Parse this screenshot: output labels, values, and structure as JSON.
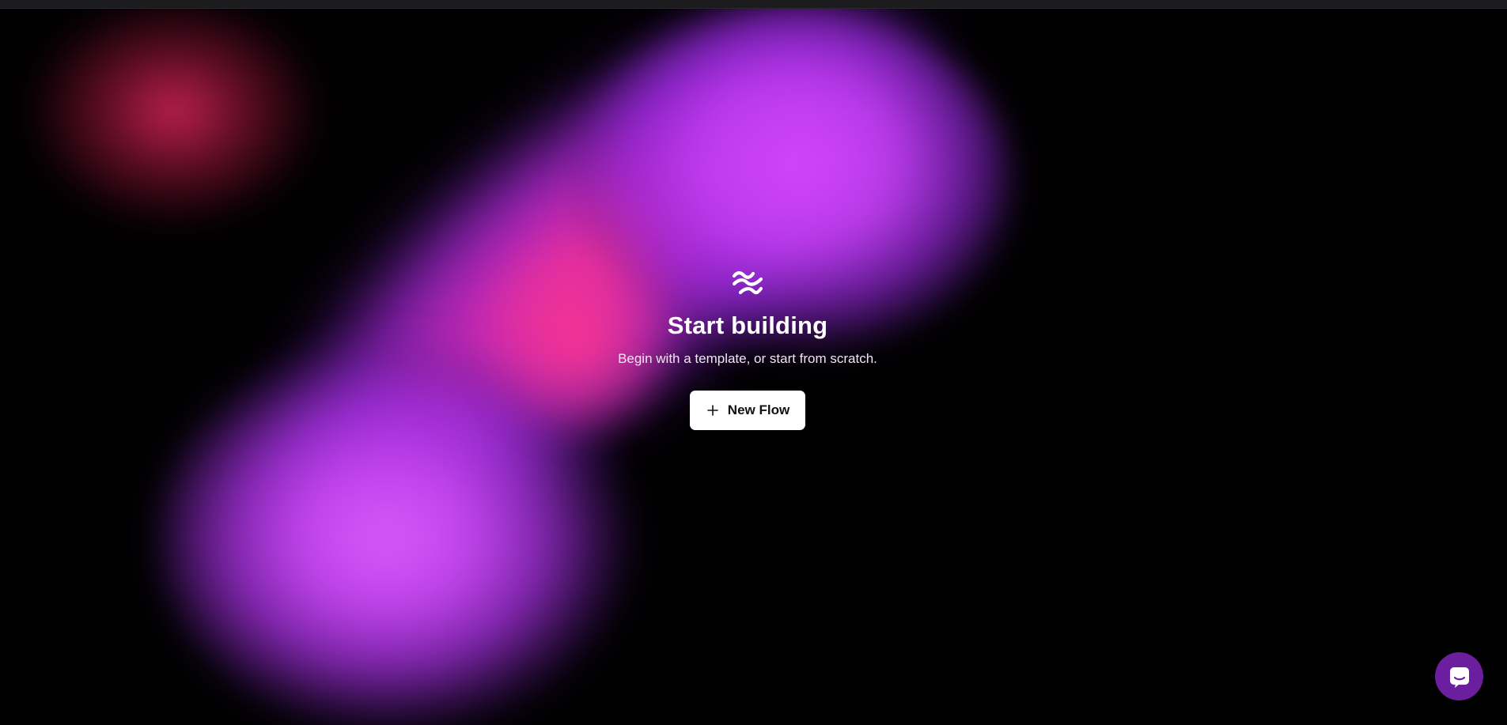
{
  "hero": {
    "logo_icon": "langflow-wave-icon",
    "title": "Start building",
    "subtitle": "Begin with a template, or start from scratch.",
    "new_flow_label": "New Flow",
    "new_flow_icon": "plus-icon"
  },
  "chat_launcher": {
    "icon": "chat-bubble-icon",
    "color": "#6b1f9e"
  },
  "colors": {
    "background": "#000000",
    "accent_magenta": "#cc44f5",
    "accent_pink": "#f5328c",
    "accent_red": "#c82250",
    "button_bg": "#ffffff"
  }
}
